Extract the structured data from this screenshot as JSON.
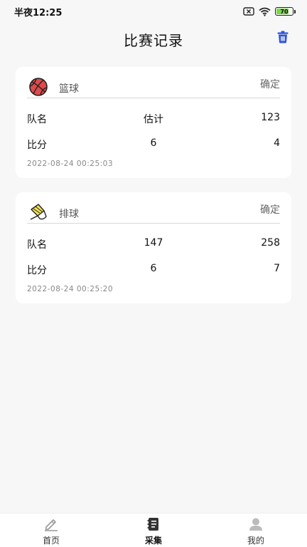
{
  "status_bar": {
    "time": "半夜12:25",
    "battery": "70"
  },
  "header": {
    "title": "比赛记录"
  },
  "records": [
    {
      "sport": "篮球",
      "icon": "basketball-icon",
      "confirm_label": "确定",
      "team_label": "队名",
      "team_a": "估计",
      "team_b": "123",
      "score_label": "比分",
      "score_a": "6",
      "score_b": "4",
      "timestamp": "2022-08-24 00:25:03"
    },
    {
      "sport": "排球",
      "icon": "shuttlecock-icon",
      "confirm_label": "确定",
      "team_label": "队名",
      "team_a": "147",
      "team_b": "258",
      "score_label": "比分",
      "score_a": "6",
      "score_b": "7",
      "timestamp": "2022-08-24 00:25:20"
    }
  ],
  "tabbar": {
    "items": [
      {
        "label": "首页",
        "icon": "pen-icon"
      },
      {
        "label": "采集",
        "icon": "notebook-icon"
      },
      {
        "label": "我的",
        "icon": "user-icon"
      }
    ],
    "active_index": 1
  },
  "colors": {
    "accent": "#2f55d4",
    "basketball": "#e04a4a",
    "background": "#f7f7f7"
  }
}
